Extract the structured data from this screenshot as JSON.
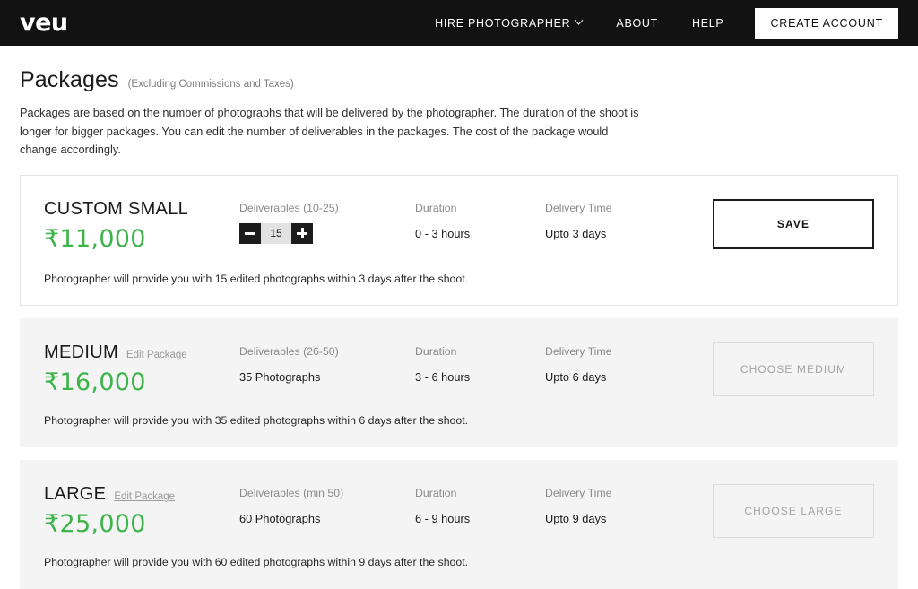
{
  "nav": {
    "logo": "veu",
    "links": [
      {
        "label": "HIRE PHOTOGRAPHER",
        "icon": "chevron-down-icon",
        "has_chevron": true
      },
      {
        "label": "ABOUT",
        "has_chevron": false
      },
      {
        "label": "HELP",
        "has_chevron": false
      }
    ],
    "cta": "CREATE ACCOUNT"
  },
  "page": {
    "title": "Packages",
    "title_note": "(Excluding Commissions and Taxes)",
    "description": "Packages are based on the number of photographs that will be delivered by the photographer. The duration of the shoot is longer for bigger packages. You can edit the number of deliverables in the packages. The cost of the package would change accordingly."
  },
  "columns": {
    "deliverables": "Deliverables",
    "duration": "Duration",
    "delivery_time": "Delivery Time"
  },
  "colors": {
    "price_green": "#3cb44a",
    "nav_background": "#121212",
    "muted_card": "#f4f4f4"
  },
  "packages": [
    {
      "name": "CUSTOM SMALL",
      "edit_link": "",
      "price": "₹11,000",
      "deliverables_label": "Deliverables (10-25)",
      "deliverables_value": "",
      "stepper": {
        "value": "15",
        "minus": "−",
        "plus": "+"
      },
      "duration_label": "Duration",
      "duration_value": "0 - 3 hours",
      "delivery_label": "Delivery Time",
      "delivery_value": "Upto 3 days",
      "action_label": "SAVE",
      "footer": "Photographer will provide you with 15 edited photographs within 3 days after the shoot."
    },
    {
      "name": "MEDIUM",
      "edit_link": "Edit Package",
      "price": "₹16,000",
      "deliverables_label": "Deliverables (26-50)",
      "deliverables_value": "35 Photographs",
      "duration_label": "Duration",
      "duration_value": "3 - 6 hours",
      "delivery_label": "Delivery Time",
      "delivery_value": "Upto 6 days",
      "action_label": "CHOOSE MEDIUM",
      "footer": "Photographer will provide you with 35 edited photographs within 6 days after the shoot."
    },
    {
      "name": "LARGE",
      "edit_link": "Edit Package",
      "price": "₹25,000",
      "deliverables_label": "Deliverables (min 50)",
      "deliverables_value": "60 Photographs",
      "duration_label": "Duration",
      "duration_value": "6 - 9 hours",
      "delivery_label": "Delivery Time",
      "delivery_value": "Upto 9 days",
      "action_label": "CHOOSE LARGE",
      "footer": "Photographer will provide you with 60 edited photographs within 9 days after the shoot."
    }
  ]
}
